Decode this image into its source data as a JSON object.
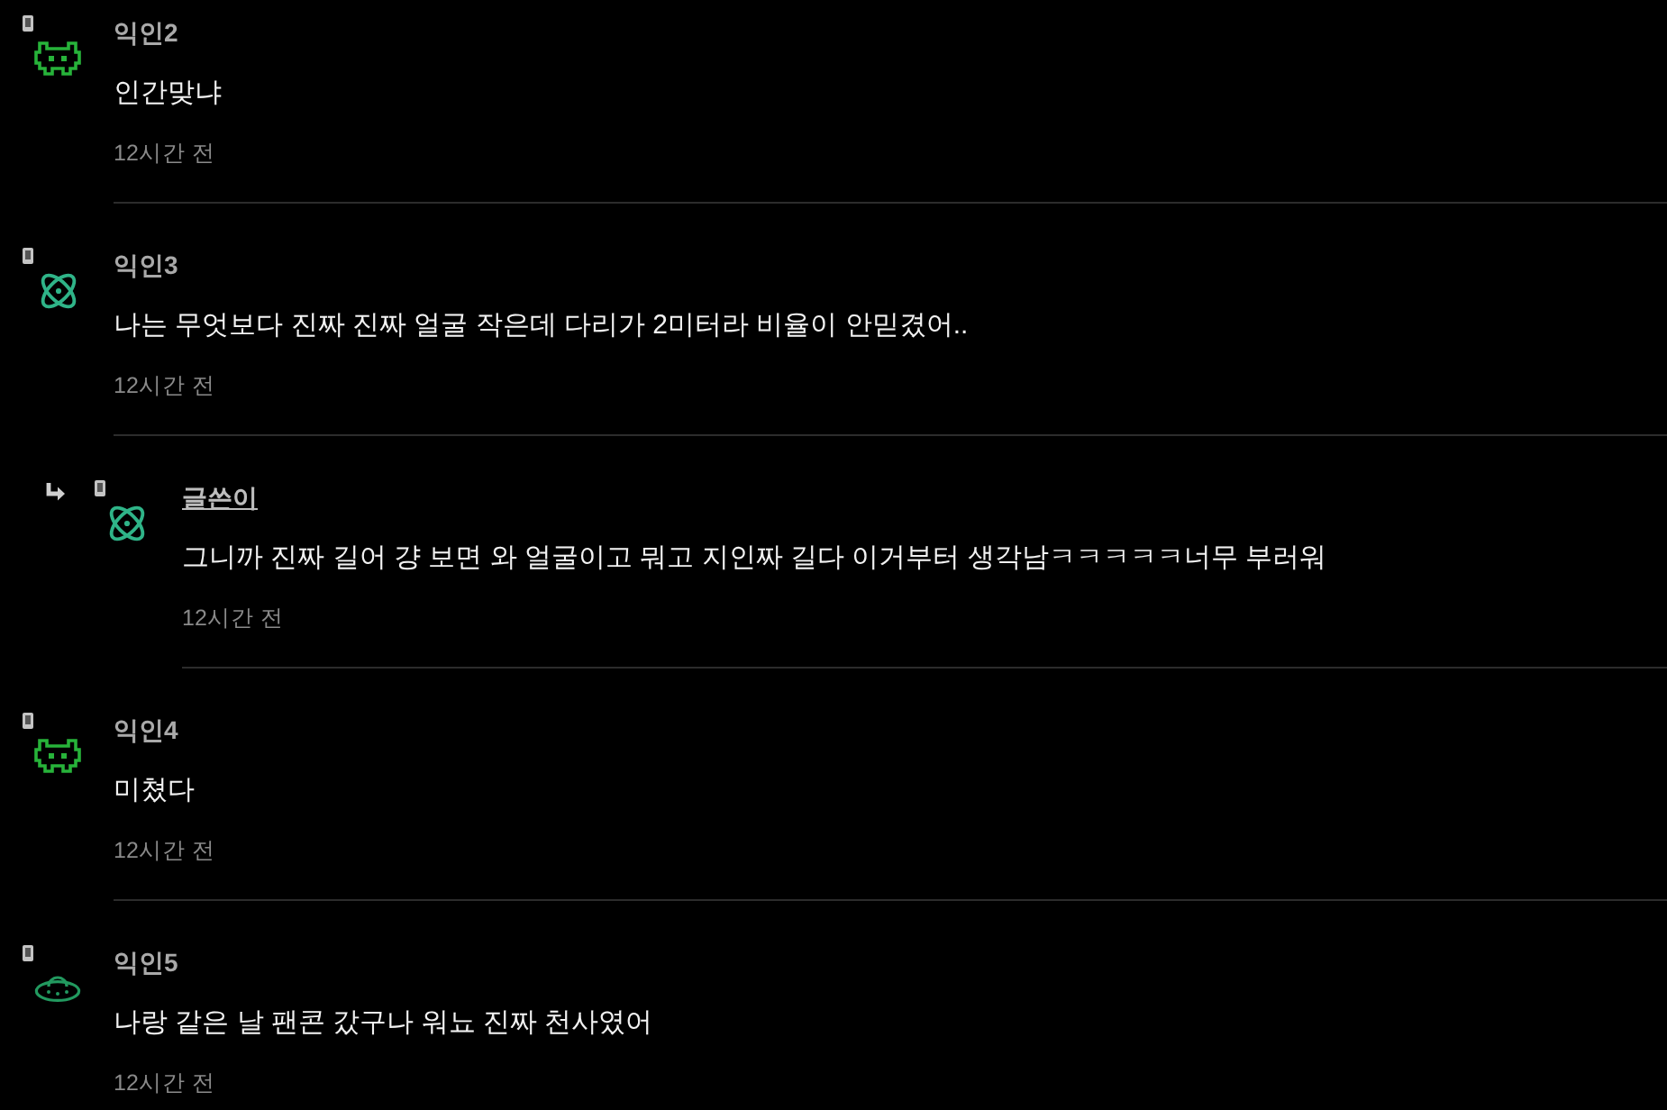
{
  "comments": [
    {
      "author": "익인2",
      "is_writer": false,
      "avatar": {
        "kind": "invader"
      },
      "text": "인간맞냐",
      "time": "12시간 전"
    },
    {
      "author": "익인3",
      "is_writer": false,
      "avatar": {
        "kind": "atom"
      },
      "text": "나는 무엇보다 진짜 진짜 얼굴 작은데 다리가 2미터라 비율이 안믿겼어..",
      "time": "12시간 전",
      "replies": [
        {
          "author": "글쓴이",
          "is_writer": true,
          "avatar": {
            "kind": "atom"
          },
          "text": "그니까 진짜 길어 걍 보면 와 얼굴이고 뭐고 지인짜 길다 이거부터 생각남ㅋㅋㅋㅋㅋ너무 부러워",
          "time": "12시간 전"
        }
      ]
    },
    {
      "author": "익인4",
      "is_writer": false,
      "avatar": {
        "kind": "invader"
      },
      "text": "미쳤다",
      "time": "12시간 전"
    },
    {
      "author": "익인5",
      "is_writer": false,
      "avatar": {
        "kind": "ufo"
      },
      "text": "나랑 같은 날 팬콘 갔구나 워뇨 진짜 천사였어",
      "time": "12시간 전"
    }
  ]
}
